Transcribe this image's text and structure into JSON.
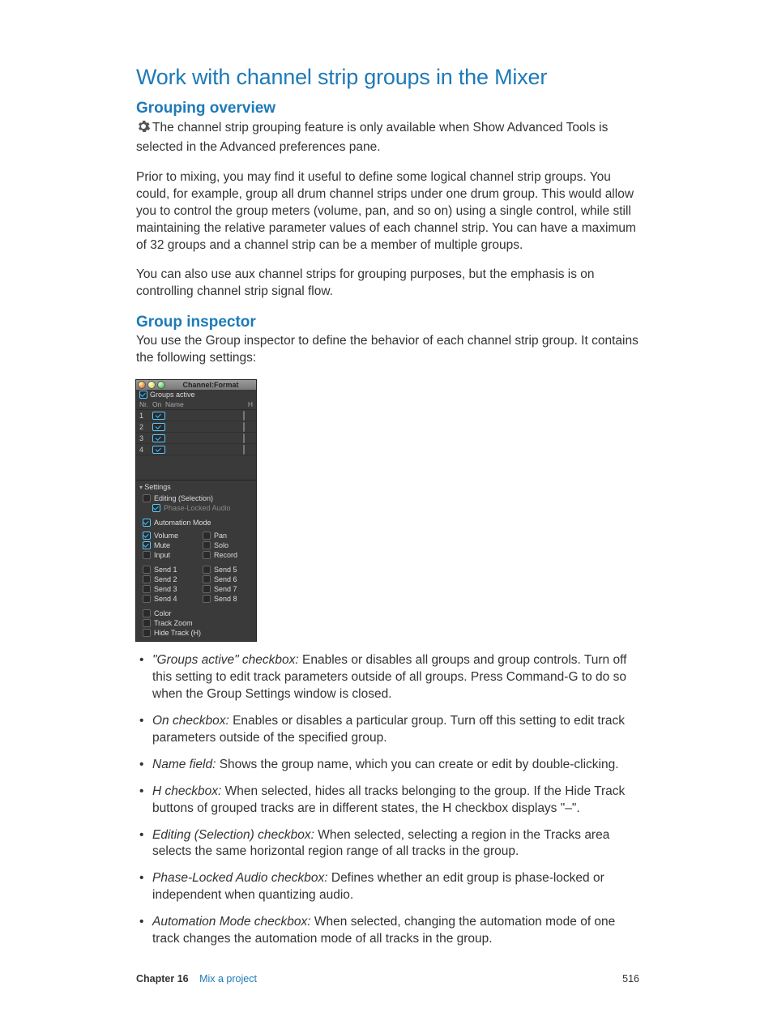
{
  "title": "Work with channel strip groups in the Mixer",
  "s1": {
    "heading": "Grouping overview",
    "p1a": "The channel strip grouping feature is only available when Show Advanced Tools is selected in the Advanced preferences pane.",
    "p2": "Prior to mixing, you may find it useful to define some logical channel strip groups. You could, for example, group all drum channel strips under one drum group. This would allow you to control the group meters (volume, pan, and so on) using a single control, while still maintaining the relative parameter values of each channel strip. You can have a maximum of 32 groups and a channel strip can be a member of multiple groups.",
    "p3": "You can also use aux channel strips for grouping purposes, but the emphasis is on controlling channel strip signal flow."
  },
  "s2": {
    "heading": "Group inspector",
    "p1": "You use the Group inspector to define the behavior of each channel strip group. It contains the following settings:"
  },
  "inspector": {
    "title": "Channel:Format",
    "groups_active": "Groups active",
    "cols": {
      "nr": "Nr.",
      "on": "On",
      "name": "Name",
      "h": "H"
    },
    "rows": [
      "1",
      "2",
      "3",
      "4"
    ],
    "settings": "Settings",
    "editing": "Editing (Selection)",
    "phase": "Phase-Locked Audio",
    "automation": "Automation Mode",
    "left": [
      "Volume",
      "Mute",
      "Input"
    ],
    "right": [
      "Pan",
      "Solo",
      "Record"
    ],
    "sends_l": [
      "Send 1",
      "Send 2",
      "Send 3",
      "Send 4"
    ],
    "sends_r": [
      "Send 5",
      "Send 6",
      "Send 7",
      "Send 8"
    ],
    "bottom": [
      "Color",
      "Track Zoom",
      "Hide Track (H)"
    ]
  },
  "bullets": [
    {
      "term": "\"Groups active\" checkbox:",
      "text": " Enables or disables all groups and group controls. Turn off this setting to edit track parameters outside of all groups. Press Command-G to do so when the Group Settings window is closed."
    },
    {
      "term": "On checkbox:",
      "text": " Enables or disables a particular group. Turn off this setting to edit track parameters outside of the specified group."
    },
    {
      "term": "Name field:",
      "text": " Shows the group name, which you can create or edit by double-clicking."
    },
    {
      "term": "H checkbox:",
      "text": " When selected, hides all tracks belonging to the group. If the Hide Track buttons of grouped tracks are in different states, the H checkbox displays \"–\"."
    },
    {
      "term": "Editing (Selection) checkbox:",
      "text": " When selected, selecting a region in the Tracks area selects the same horizontal region range of all tracks in the group."
    },
    {
      "term": "Phase-Locked Audio checkbox:",
      "text": " Defines whether an edit group is phase-locked or independent when quantizing audio."
    },
    {
      "term": "Automation Mode checkbox:",
      "text": " When selected, changing the automation mode of one track changes the automation mode of all tracks in the group."
    }
  ],
  "footer": {
    "chapter": "Chapter  16",
    "section": "Mix a project",
    "page": "516"
  }
}
